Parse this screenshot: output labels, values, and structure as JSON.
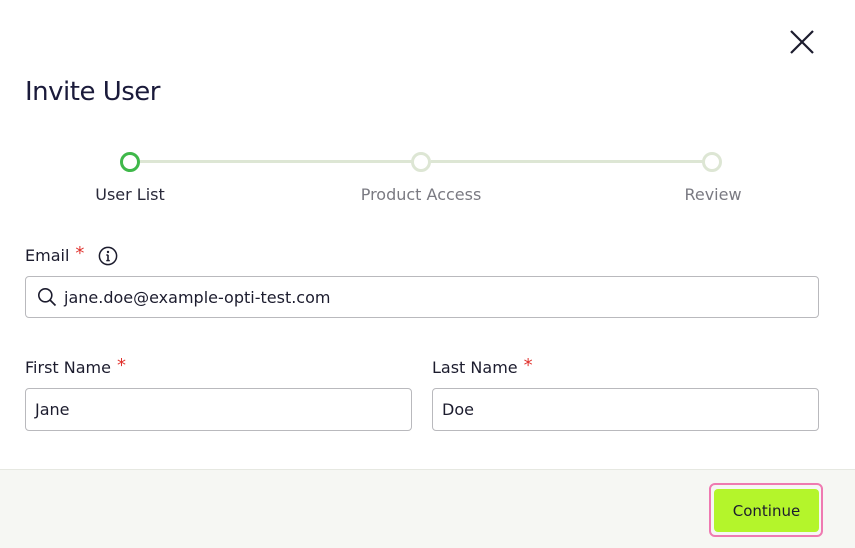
{
  "dialog": {
    "title": "Invite User",
    "close_icon": "close-icon"
  },
  "stepper": {
    "steps": [
      {
        "label": "User List",
        "state": "active"
      },
      {
        "label": "Product Access",
        "state": "inactive"
      },
      {
        "label": "Review",
        "state": "inactive"
      }
    ],
    "active_color": "#3fb84a",
    "inactive_color": "#dde6d4"
  },
  "form": {
    "email": {
      "label": "Email",
      "required_marker": "*",
      "info_icon": "info-icon",
      "search_icon": "search-icon",
      "value": "jane.doe@example-opti-test.com"
    },
    "first_name": {
      "label": "First Name",
      "required_marker": "*",
      "value": "Jane"
    },
    "last_name": {
      "label": "Last Name",
      "required_marker": "*",
      "value": "Doe"
    }
  },
  "footer": {
    "continue_label": "Continue",
    "continue_color": "#b4f52b",
    "focus_ring_color": "#ef7ab1"
  }
}
